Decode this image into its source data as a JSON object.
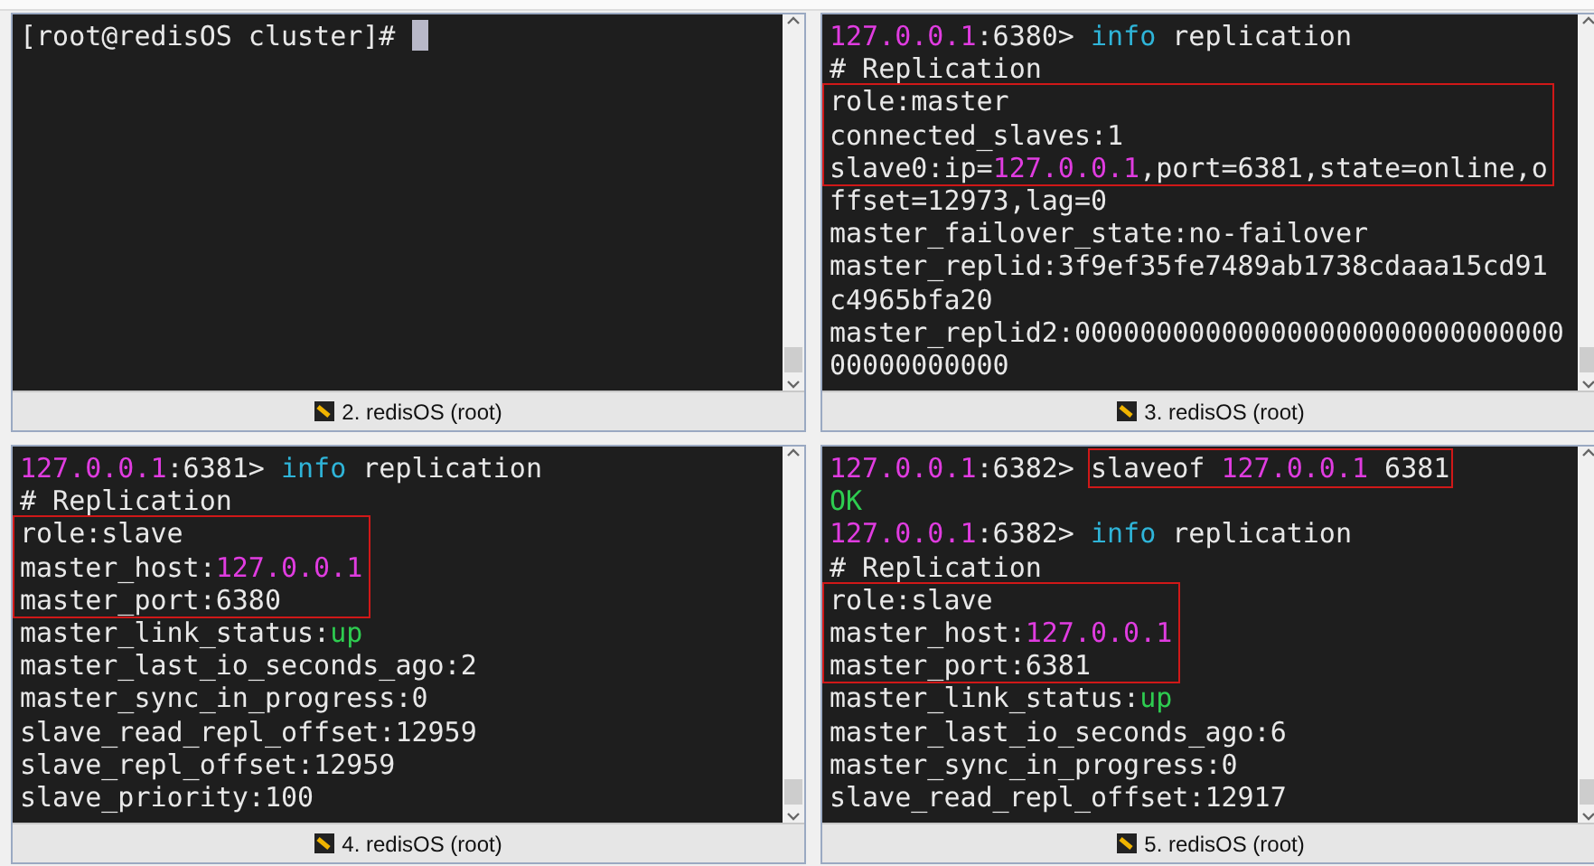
{
  "panes": [
    {
      "tab": "2. redisOS (root)",
      "cursor": true,
      "blocks": [
        {
          "lines": [
            [
              {
                "text": "[root@redisOS cluster]# ",
                "kind": "text"
              }
            ]
          ]
        }
      ]
    },
    {
      "tab": "3. redisOS (root)",
      "blocks": [
        {
          "lines": [
            [
              {
                "text": "127.0.0.1",
                "kind": "ip"
              },
              {
                "text": ":6380> ",
                "kind": "text"
              },
              {
                "text": "info",
                "kind": "cmd"
              },
              {
                "text": " replication",
                "kind": "text"
              }
            ],
            [
              {
                "text": "# Replication",
                "kind": "text"
              }
            ]
          ]
        },
        {
          "boxed": true,
          "lines": [
            [
              {
                "text": "role:master",
                "kind": "text"
              }
            ],
            [
              {
                "text": "connected_slaves:1",
                "kind": "text"
              }
            ],
            [
              {
                "text": "slave0:ip=",
                "kind": "text"
              },
              {
                "text": "127.0.0.1",
                "kind": "ip"
              },
              {
                "text": ",port=6381,state=online,o",
                "kind": "text"
              }
            ]
          ]
        },
        {
          "lines": [
            [
              {
                "text": "ffset=12973,lag=0",
                "kind": "text"
              }
            ],
            [
              {
                "text": "master_failover_state:no-failover",
                "kind": "text"
              }
            ],
            [
              {
                "text": "master_replid:3f9ef35fe7489ab1738cdaaa15cd91",
                "kind": "text"
              }
            ],
            [
              {
                "text": "c4965bfa20",
                "kind": "text"
              }
            ],
            [
              {
                "text": "master_replid2:000000000000000000000000000000",
                "kind": "text"
              }
            ],
            [
              {
                "text": "00000000000",
                "kind": "text"
              }
            ]
          ]
        }
      ]
    },
    {
      "tab": "4. redisOS (root)",
      "blocks": [
        {
          "lines": [
            [
              {
                "text": "127.0.0.1",
                "kind": "ip"
              },
              {
                "text": ":6381> ",
                "kind": "text"
              },
              {
                "text": "info",
                "kind": "cmd"
              },
              {
                "text": " replication",
                "kind": "text"
              }
            ],
            [
              {
                "text": "# Replication",
                "kind": "text"
              }
            ]
          ]
        },
        {
          "boxed": true,
          "lines": [
            [
              {
                "text": "role:slave",
                "kind": "text"
              }
            ],
            [
              {
                "text": "master_host:",
                "kind": "text"
              },
              {
                "text": "127.0.0.1",
                "kind": "ip"
              }
            ],
            [
              {
                "text": "master_port:6380",
                "kind": "text"
              }
            ]
          ]
        },
        {
          "lines": [
            [
              {
                "text": "master_link_status:",
                "kind": "text"
              },
              {
                "text": "up",
                "kind": "ok"
              }
            ],
            [
              {
                "text": "master_last_io_seconds_ago:2",
                "kind": "text"
              }
            ],
            [
              {
                "text": "master_sync_in_progress:0",
                "kind": "text"
              }
            ],
            [
              {
                "text": "slave_read_repl_offset:12959",
                "kind": "text"
              }
            ],
            [
              {
                "text": "slave_repl_offset:12959",
                "kind": "text"
              }
            ],
            [
              {
                "text": "slave_priority:100",
                "kind": "text"
              }
            ]
          ]
        }
      ]
    },
    {
      "tab": "5. redisOS (root)",
      "blocks": [
        {
          "lines": [
            [
              {
                "text": "127.0.0.1",
                "kind": "ip"
              },
              {
                "text": ":6382> ",
                "kind": "text"
              },
              {
                "boxed": true,
                "parts": [
                  {
                    "text": "slaveof ",
                    "kind": "text"
                  },
                  {
                    "text": "127.0.0.1",
                    "kind": "ip"
                  },
                  {
                    "text": " 6381",
                    "kind": "text"
                  }
                ]
              }
            ],
            [
              {
                "text": "OK",
                "kind": "ok"
              }
            ],
            [
              {
                "text": "127.0.0.1",
                "kind": "ip"
              },
              {
                "text": ":6382> ",
                "kind": "text"
              },
              {
                "text": "info",
                "kind": "cmd"
              },
              {
                "text": " replication",
                "kind": "text"
              }
            ],
            [
              {
                "text": "# Replication",
                "kind": "text"
              }
            ]
          ]
        },
        {
          "boxed": true,
          "lines": [
            [
              {
                "text": "role:slave",
                "kind": "text"
              }
            ],
            [
              {
                "text": "master_host:",
                "kind": "text"
              },
              {
                "text": "127.0.0.1",
                "kind": "ip"
              }
            ],
            [
              {
                "text": "master_port:6381",
                "kind": "text"
              }
            ]
          ]
        },
        {
          "lines": [
            [
              {
                "text": "master_link_status:",
                "kind": "text"
              },
              {
                "text": "up",
                "kind": "ok"
              }
            ],
            [
              {
                "text": "master_last_io_seconds_ago:6",
                "kind": "text"
              }
            ],
            [
              {
                "text": "master_sync_in_progress:0",
                "kind": "text"
              }
            ],
            [
              {
                "text": "slave_read_repl_offset:12917",
                "kind": "text"
              }
            ]
          ]
        }
      ]
    }
  ]
}
